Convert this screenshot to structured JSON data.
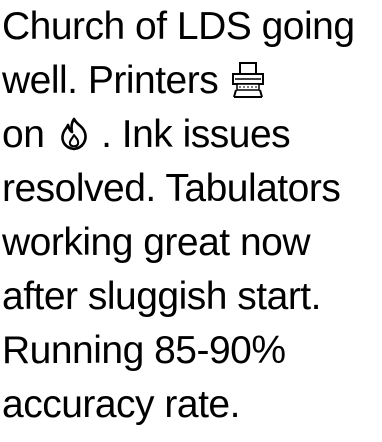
{
  "note": {
    "line1": "Church of LDS going",
    "line2_text": "well.  Printers",
    "line2_icon": "printer-icon",
    "line3_pre": "on",
    "line3_icon": "fire-icon",
    "line3_post": ".  Ink issues",
    "line4": "resolved. Tabulators",
    "line5": "working great now",
    "line6": "after sluggish start.",
    "line7": "Running 85-90%",
    "line8": "accuracy rate."
  }
}
